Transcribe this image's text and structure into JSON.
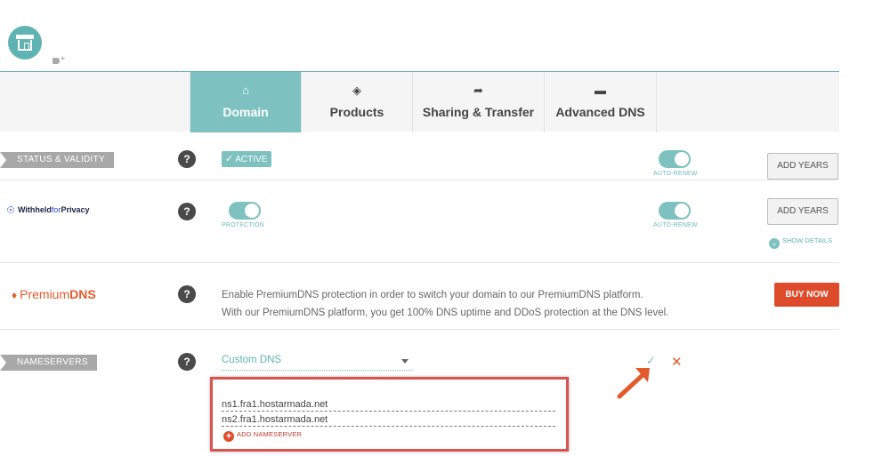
{
  "header": {
    "store_icon": "store-icon",
    "tag_icon": "tag-add-icon"
  },
  "tabs": [
    {
      "label": "Domain",
      "icon": "home-icon",
      "glyph": "⌂",
      "active": true
    },
    {
      "label": "Products",
      "icon": "box-icon",
      "glyph": "◈",
      "active": false
    },
    {
      "label": "Sharing & Transfer",
      "icon": "house-arrow-icon",
      "glyph": "➦",
      "active": false
    },
    {
      "label": "Advanced DNS",
      "icon": "router-icon",
      "glyph": "▬",
      "active": false
    }
  ],
  "status": {
    "label": "STATUS & VALIDITY",
    "help": "?",
    "badge": "ACTIVE",
    "badge_check": "✓",
    "autorenew_label": "AUTO-RENEW",
    "autorenew_on": true,
    "add_years": "ADD YEARS"
  },
  "privacy": {
    "logo_bold": "Withheld",
    "logo_for": "for",
    "logo_end": "Privacy",
    "help": "?",
    "protection_label": "PROTECTION",
    "protection_on": true,
    "autorenew_label": "AUTO-RENEW",
    "autorenew_on": true,
    "add_years": "ADD YEARS",
    "show_details": "SHOW DETAILS",
    "show_details_chev": "⌄"
  },
  "premium": {
    "logo_gem": "♦",
    "logo_plain": "Premium",
    "logo_bold": "DNS",
    "help": "?",
    "line1": "Enable PremiumDNS protection in order to switch your domain to our PremiumDNS platform.",
    "line2": "With our PremiumDNS platform, you get 100% DNS uptime and DDoS protection at the DNS level.",
    "buy_now": "BUY NOW"
  },
  "nameservers": {
    "label": "NAMESERVERS",
    "help": "?",
    "selected": "Custom DNS",
    "confirm": "✓",
    "cancel": "✕",
    "servers": [
      "ns1.fra1.hostarmada.net",
      "ns2.fra1.hostarmada.net"
    ],
    "add_label": "ADD NAMESERVER",
    "add_plus": "+"
  },
  "colors": {
    "teal": "#7ec1c1",
    "accent_red": "#dd4b2a",
    "highlight_border": "#d9534f"
  }
}
